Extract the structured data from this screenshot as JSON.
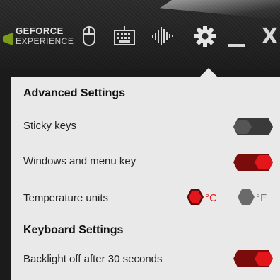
{
  "header": {
    "logo_line1": "GEFORCE",
    "logo_line2": "EXPERIENCE",
    "icons": [
      "mouse-icon",
      "keyboard-icon",
      "audio-waveform-icon",
      "gear-icon",
      "minimize-icon",
      "close-icon"
    ],
    "close_glyph": "X"
  },
  "panel": {
    "advanced_heading": "Advanced Settings",
    "settings": [
      {
        "label": "Sticky keys",
        "on": false
      },
      {
        "label": "Windows and menu key",
        "on": true
      }
    ],
    "temperature": {
      "label": "Temperature units",
      "celsius": "°C",
      "fahrenheit": "°F",
      "selected": "celsius"
    },
    "keyboard_heading": "Keyboard Settings",
    "backlight": {
      "label": "Backlight off after 30 seconds",
      "on": true
    }
  },
  "colors": {
    "accent_red": "#e4161b",
    "toggle_on_dark": "#7a0c0c",
    "toggle_off": "#3a3a3a",
    "panel_bg": "#e9e9e9"
  }
}
